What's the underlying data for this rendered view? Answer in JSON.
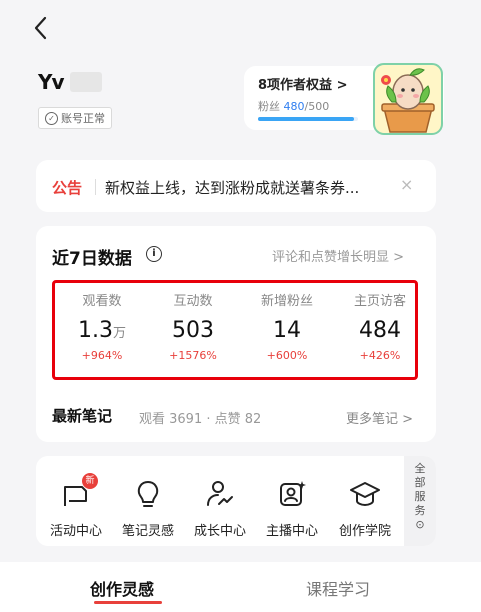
{
  "header": {
    "username": "Yv",
    "account_status": "账号正常",
    "rights_title": "8项作者权益 >",
    "fans_label": "粉丝",
    "fans_current": "480",
    "fans_target": "/500",
    "fans_progress": 0.96
  },
  "notice": {
    "tag": "公告",
    "text": "新权益上线，达到涨粉成就送薯条券...",
    "close": "×"
  },
  "data": {
    "title": "近7日数据",
    "info": "i",
    "hint": "评论和点赞增长明显 >",
    "metrics": [
      {
        "label": "观看数",
        "value": "1.3",
        "unit": "万",
        "change": "+964%"
      },
      {
        "label": "互动数",
        "value": "503",
        "unit": "",
        "change": "+1576%"
      },
      {
        "label": "新增粉丝",
        "value": "14",
        "unit": "",
        "change": "+600%"
      },
      {
        "label": "主页访客",
        "value": "484",
        "unit": "",
        "change": "+426%"
      }
    ],
    "notes_title": "最新笔记",
    "notes_stats": "观看 3691 · 点赞 82",
    "notes_more": "更多笔记 >"
  },
  "services": {
    "items": [
      {
        "label": "活动中心",
        "icon": "flag-icon"
      },
      {
        "label": "笔记灵感",
        "icon": "lightbulb-icon"
      },
      {
        "label": "成长中心",
        "icon": "growth-icon"
      },
      {
        "label": "主播中心",
        "icon": "anchor-icon"
      },
      {
        "label": "创作学院",
        "icon": "graduation-cap-icon"
      }
    ],
    "new_badge": "新",
    "all_services": [
      "全",
      "部",
      "服",
      "务",
      "⊙"
    ]
  },
  "tabs": {
    "active": "创作灵感",
    "inactive": "课程学习"
  },
  "colors": {
    "accent": "#e8403b",
    "highlight_box": "#e8000b",
    "progress": "#3aa5f5"
  }
}
